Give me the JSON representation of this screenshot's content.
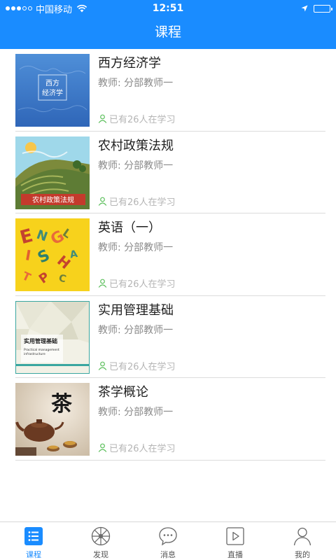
{
  "status_bar": {
    "carrier": "中国移动",
    "time": "12:51",
    "battery_level": 0.95
  },
  "nav": {
    "title": "课程"
  },
  "courses": [
    {
      "title": "西方经济学",
      "teacher": "教师: 分部教师一",
      "learners": "已有26人在学习",
      "thumb_text": [
        "西方",
        "经济学"
      ]
    },
    {
      "title": "农村政策法规",
      "teacher": "教师: 分部教师一",
      "learners": "已有26人在学习",
      "thumb_text": [
        "农村政策法规"
      ]
    },
    {
      "title": "英语（一）",
      "teacher": "教师: 分部教师一",
      "learners": "已有26人在学习",
      "thumb_text": [
        "ENGLISH"
      ]
    },
    {
      "title": "实用管理基础",
      "teacher": "教师: 分部教师一",
      "learners": "已有26人在学习",
      "thumb_text": [
        "实用管理基础",
        "Practical management",
        "infrastructure"
      ]
    },
    {
      "title": "茶学概论",
      "teacher": "教师: 分部教师一",
      "learners": "已有26人在学习",
      "thumb_text": [
        "茶"
      ]
    }
  ],
  "tabbar": {
    "items": [
      {
        "label": "课程",
        "icon": "list-icon",
        "active": true
      },
      {
        "label": "发现",
        "icon": "compass-wheel-icon",
        "active": false
      },
      {
        "label": "消息",
        "icon": "chat-bubble-icon",
        "active": false
      },
      {
        "label": "直播",
        "icon": "play-icon",
        "active": false
      },
      {
        "label": "我的",
        "icon": "user-icon",
        "active": false
      }
    ]
  },
  "colors": {
    "brand": "#1a8cff",
    "learners_icon": "#5cbf5c"
  }
}
